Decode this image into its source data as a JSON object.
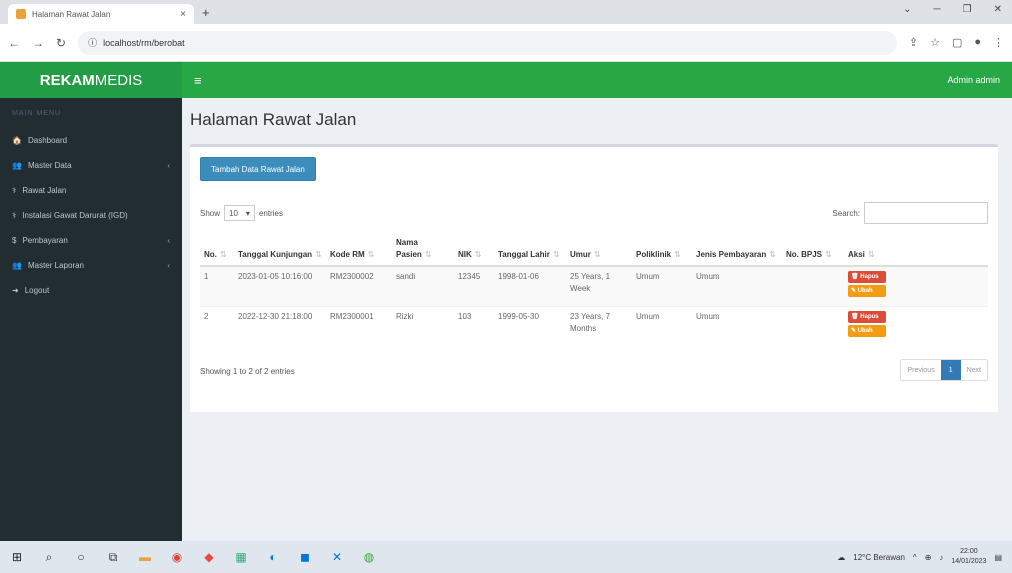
{
  "browser": {
    "tab_title": "Halaman Rawat Jalan",
    "url": "localhost/rm/berobat",
    "new_tab": "+",
    "close": "×"
  },
  "app": {
    "brand_bold": "REKAM",
    "brand_rest": " MEDIS",
    "user": "Admin admin"
  },
  "sidebar": {
    "header": "MAIN MENU",
    "items": [
      {
        "label": "Dashboard",
        "icon": "🏠",
        "has_children": false
      },
      {
        "label": "Master Data",
        "icon": "👥",
        "has_children": true
      },
      {
        "label": "Rawat Jalan",
        "icon": "⚕",
        "has_children": false
      },
      {
        "label": "Instalasi Gawat Darurat (IGD)",
        "icon": "⚕",
        "has_children": false
      },
      {
        "label": "Pembayaran",
        "icon": "$",
        "has_children": true
      },
      {
        "label": "Master Laporan",
        "icon": "👥",
        "has_children": true
      },
      {
        "label": "Logout",
        "icon": "➜",
        "has_children": false
      }
    ]
  },
  "main": {
    "title": "Halaman Rawat Jalan",
    "add_button": "Tambah Data Rawat Jalan",
    "show_label": "Show",
    "entries_value": "10",
    "entries_label": "entries",
    "search_label": "Search:",
    "search_value": "",
    "columns": [
      "No.",
      "Tanggal Kunjungan",
      "Kode RM",
      "Nama Pasien",
      "NIK",
      "Tanggal Lahir",
      "Umur",
      "Poliklinik",
      "Jenis Pembayaran",
      "No. BPJS",
      "Aksi"
    ],
    "rows": [
      [
        "1",
        "2023-01-05 10:16:00",
        "RM2300002",
        "sandi",
        "12345",
        "1998-01-06",
        "25 Years, 1 Week",
        "Umum",
        "Umum",
        ""
      ],
      [
        "2",
        "2022-12-30 21:18:00",
        "RM2300001",
        "Rizki",
        "103",
        "1999-05-30",
        "23 Years, 7 Months",
        "Umum",
        "Umum",
        ""
      ]
    ],
    "hapus_label": "Hapus",
    "ubah_label": "Ubah",
    "info": "Showing 1 to 2 of 2 entries",
    "prev": "Previous",
    "page": "1",
    "next": "Next"
  },
  "taskbar": {
    "weather": "12°C Berawan",
    "time": "22:00",
    "date": "14/01/2023"
  }
}
